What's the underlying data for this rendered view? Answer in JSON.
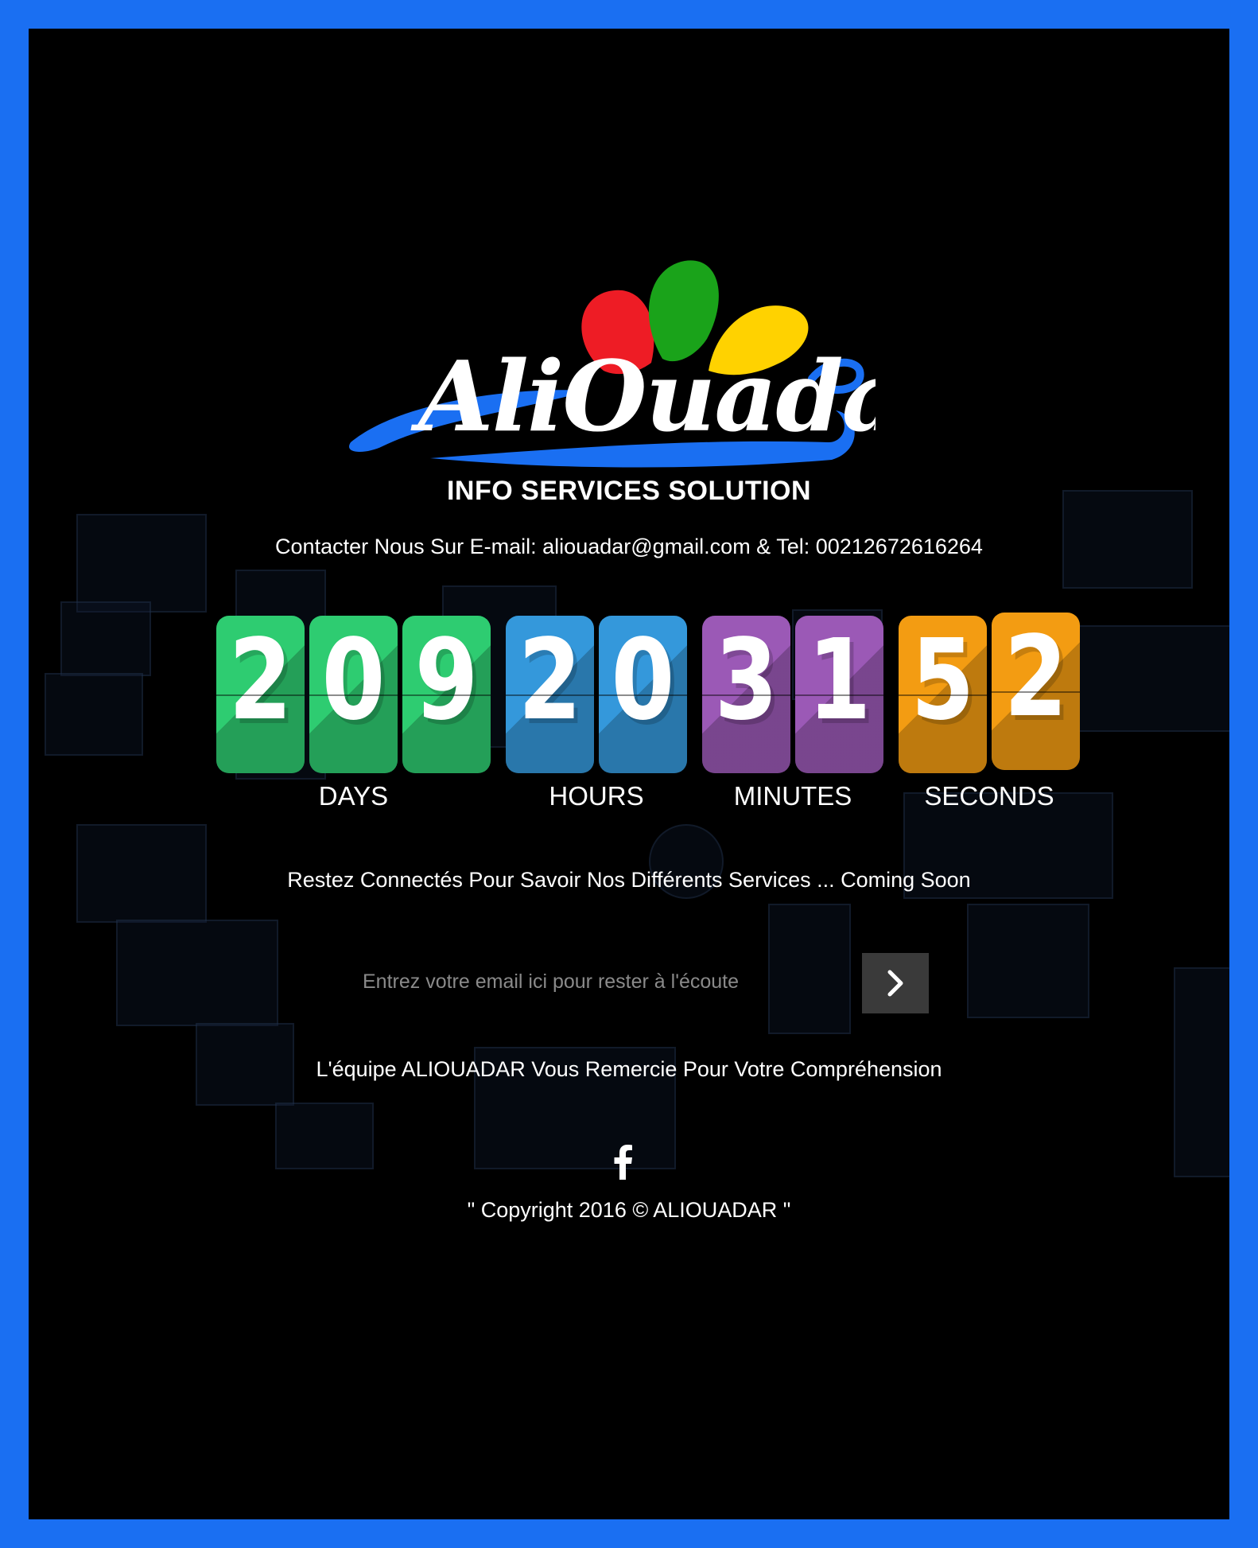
{
  "brand": {
    "logo_text": "AliOuadaR",
    "tagline": "INFO SERVICES SOLUTION",
    "contact": "Contacter Nous Sur E-mail: aliouadar@gmail.com & Tel: 00212672616264"
  },
  "countdown": {
    "days": {
      "digits": [
        "2",
        "0",
        "9"
      ],
      "label": "DAYS",
      "color": "#2ecc71"
    },
    "hours": {
      "digits": [
        "2",
        "0"
      ],
      "label": "HOURS",
      "color": "#3498db"
    },
    "minutes": {
      "digits": [
        "3",
        "1"
      ],
      "label": "MINUTES",
      "color": "#9b59b6"
    },
    "seconds": {
      "digits": [
        "5",
        "2"
      ],
      "label": "SECONDS",
      "color": "#f39c12"
    }
  },
  "message": "Restez Connectés Pour Savoir Nos Différents Services ... Coming Soon",
  "subscribe": {
    "placeholder": "Entrez votre email ici pour rester à l'écoute",
    "value": "",
    "submit_icon": "chevron-right-icon"
  },
  "thanks": "L'équipe ALIOUADAR Vous Remercie Pour Votre Compréhension",
  "social": {
    "icon": "facebook-icon"
  },
  "copyright": "\" Copyright 2016 © ALIOUADAR \"",
  "colors": {
    "frame_border": "#1a6ff2",
    "background": "#000000",
    "logo_blue": "#1a6ff2",
    "petal_red": "#ee1c25",
    "petal_green": "#1aa31a",
    "petal_yellow": "#ffd200"
  }
}
